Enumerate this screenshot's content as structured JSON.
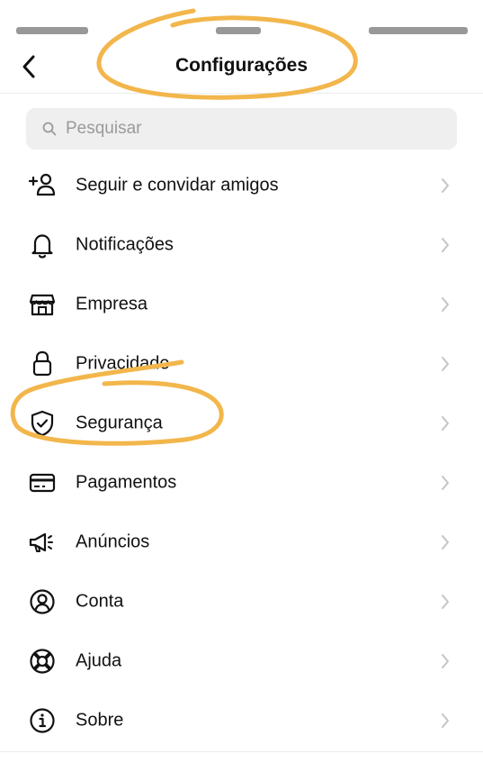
{
  "header": {
    "title": "Configurações"
  },
  "search": {
    "placeholder": "Pesquisar"
  },
  "menu": {
    "items": [
      {
        "label": "Seguir e convidar amigos",
        "icon": "add-person-icon"
      },
      {
        "label": "Notificações",
        "icon": "bell-icon"
      },
      {
        "label": "Empresa",
        "icon": "shop-icon"
      },
      {
        "label": "Privacidade",
        "icon": "lock-icon"
      },
      {
        "label": "Segurança",
        "icon": "shield-check-icon"
      },
      {
        "label": "Pagamentos",
        "icon": "credit-card-icon"
      },
      {
        "label": "Anúncios",
        "icon": "megaphone-icon"
      },
      {
        "label": "Conta",
        "icon": "account-circle-icon"
      },
      {
        "label": "Ajuda",
        "icon": "lifebuoy-icon"
      },
      {
        "label": "Sobre",
        "icon": "info-icon"
      }
    ]
  },
  "colors": {
    "highlight": "#f2b64b",
    "chevron": "#c4c4c4",
    "search_bg": "#efefef",
    "text": "#111111"
  }
}
